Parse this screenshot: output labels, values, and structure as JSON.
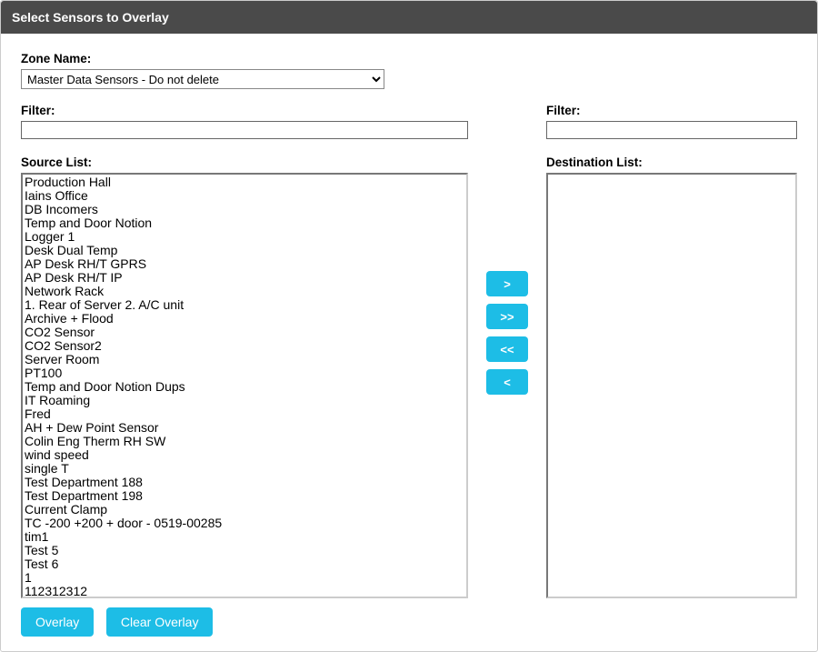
{
  "title": "Select Sensors to Overlay",
  "zone": {
    "label": "Zone Name:",
    "selected": "Master Data Sensors - Do not delete"
  },
  "source": {
    "filter_label": "Filter:",
    "filter_value": "",
    "list_label": "Source List:",
    "items": [
      "Production Hall",
      "Iains Office",
      "DB Incomers",
      "Temp and Door Notion",
      "Logger 1",
      "Desk Dual Temp",
      "AP Desk RH/T GPRS",
      "AP Desk RH/T IP",
      "Network Rack",
      "1. Rear of Server 2. A/C unit",
      "Archive + Flood",
      "CO2 Sensor",
      "CO2 Sensor2",
      "Server Room",
      "PT100",
      "Temp and Door Notion Dups",
      "IT Roaming",
      "Fred",
      "AH + Dew Point Sensor",
      "Colin Eng Therm RH SW",
      "wind speed",
      "single T",
      "Test Department 188",
      "Test Department 198",
      "Current Clamp",
      "TC -200 +200 + door - 0519-00285",
      "tim1",
      "Test 5",
      "Test 6",
      "1",
      "112312312"
    ]
  },
  "destination": {
    "filter_label": "Filter:",
    "filter_value": "",
    "list_label": "Destination List:",
    "items": []
  },
  "transfer": {
    "add": ">",
    "add_all": ">>",
    "remove_all": "<<",
    "remove": "<"
  },
  "actions": {
    "overlay": "Overlay",
    "clear": "Clear Overlay"
  }
}
